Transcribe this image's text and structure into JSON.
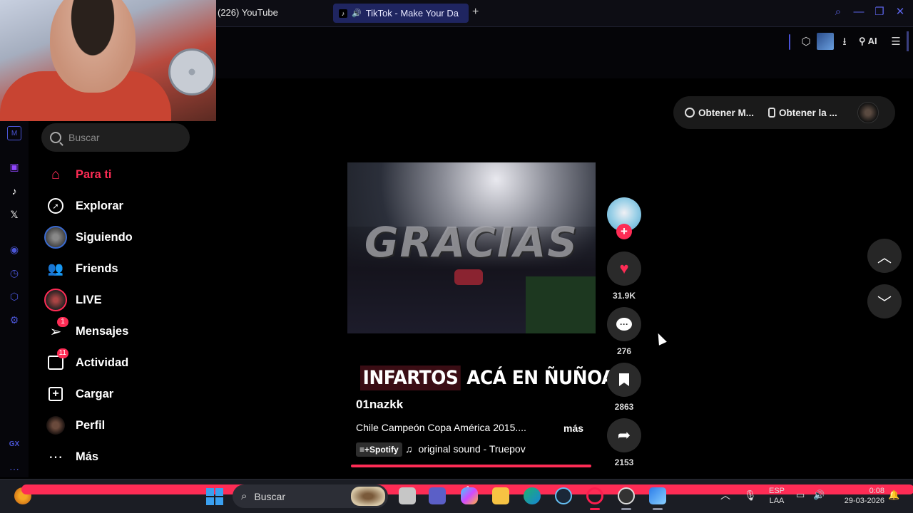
{
  "browser": {
    "tabs": [
      {
        "title": "(226) YouTube"
      },
      {
        "title": "TikTok - Make Your Da"
      }
    ],
    "new_tab": "+",
    "ai_label": "AI"
  },
  "colors": {
    "accent": "#fe2c55",
    "opera_blue": "#4a55d6",
    "background": "#000000"
  },
  "sidebar": {
    "search_placeholder": "Buscar",
    "items": [
      {
        "label": "Para ti",
        "icon": "home-icon",
        "active": true
      },
      {
        "label": "Explorar",
        "icon": "compass-icon"
      },
      {
        "label": "Siguiendo",
        "icon": "following-avatar-icon"
      },
      {
        "label": "Friends",
        "icon": "friends-icon"
      },
      {
        "label": "LIVE",
        "icon": "live-avatar-icon"
      },
      {
        "label": "Mensajes",
        "icon": "messages-icon",
        "badge": "1"
      },
      {
        "label": "Actividad",
        "icon": "activity-icon",
        "badge": "11"
      },
      {
        "label": "Cargar",
        "icon": "upload-icon"
      },
      {
        "label": "Perfil",
        "icon": "profile-avatar-icon"
      },
      {
        "label": "Más",
        "icon": "more-icon"
      }
    ]
  },
  "topbar": {
    "get_app_1": "Obtener M...",
    "get_app_2": "Obtener la ..."
  },
  "video": {
    "overlay_text": "GRACIAS",
    "caption_highlight": "INFARTOS",
    "caption_rest": " ACÁ EN ÑUÑOA",
    "username": "01nazkk",
    "description": "Chile Campeón Copa América 2015....",
    "more": "más",
    "spotify_tag": "Spotify",
    "sound": "original sound - Truepov",
    "progress": 1.0
  },
  "actions": {
    "likes": "31.9K",
    "comments": "276",
    "saves": "2863",
    "shares": "2153"
  },
  "taskbar": {
    "search_label": "Buscar",
    "lang_line1": "ESP",
    "lang_line2": "LAA",
    "time": "0:08",
    "date": "29-03-2026",
    "notification_badge": "1"
  },
  "opera_rail": {
    "gx_label": "GX"
  }
}
